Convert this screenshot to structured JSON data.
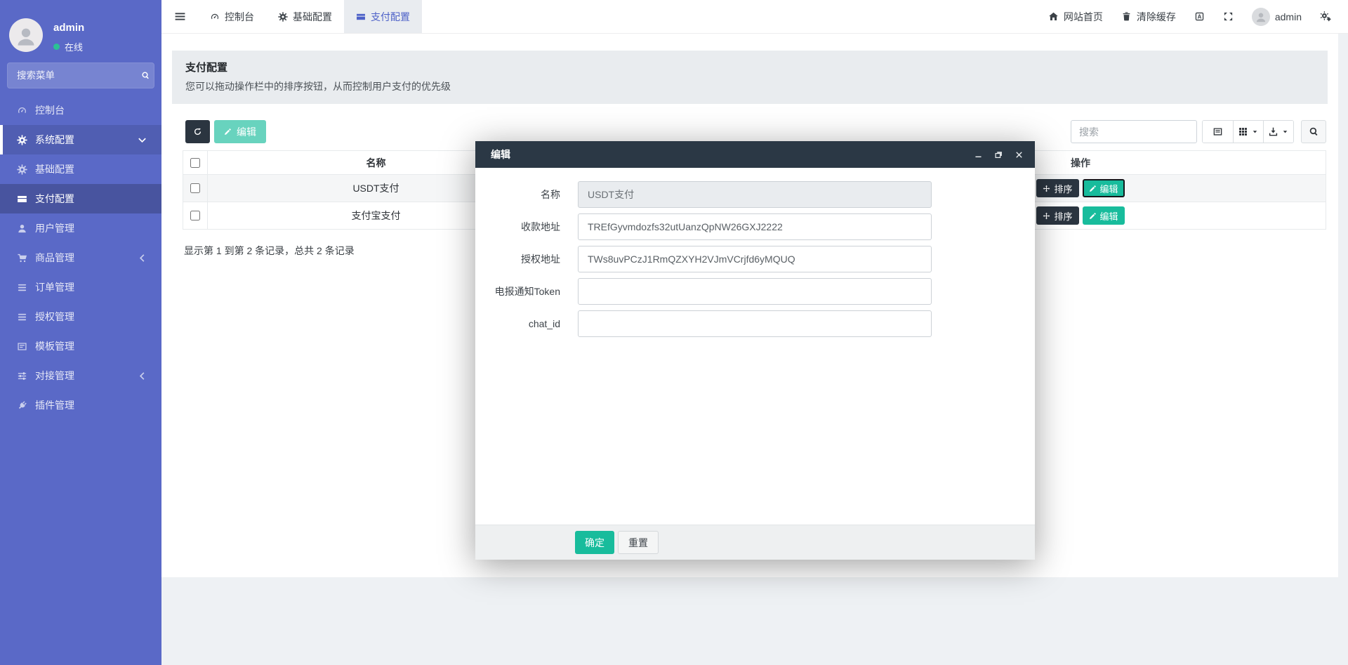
{
  "sidebar": {
    "user_name": "admin",
    "user_status": "在线",
    "search_placeholder": "搜索菜单",
    "items": [
      {
        "label": "控制台",
        "icon": "gauge-icon"
      },
      {
        "label": "系统配置",
        "icon": "gear-icon"
      },
      {
        "label": "基础配置",
        "icon": "gear-icon"
      },
      {
        "label": "支付配置",
        "icon": "payment-icon"
      },
      {
        "label": "用户管理",
        "icon": "user-icon"
      },
      {
        "label": "商品管理",
        "icon": "cart-icon"
      },
      {
        "label": "订单管理",
        "icon": "list-icon"
      },
      {
        "label": "授权管理",
        "icon": "list-icon"
      },
      {
        "label": "模板管理",
        "icon": "template-icon"
      },
      {
        "label": "对接管理",
        "icon": "sliders-icon"
      },
      {
        "label": "插件管理",
        "icon": "plug-icon"
      }
    ]
  },
  "navbar": {
    "tabs": [
      {
        "label": "控制台"
      },
      {
        "label": "基础配置"
      },
      {
        "label": "支付配置"
      }
    ],
    "home_label": "网站首页",
    "clear_cache_label": "清除缓存",
    "user_name": "admin"
  },
  "page": {
    "title": "支付配置",
    "subtitle": "您可以拖动操作栏中的排序按钮，从而控制用户支付的优先级"
  },
  "toolbar": {
    "edit_label": "编辑",
    "search_placeholder": "搜索"
  },
  "table": {
    "name_column": "名称",
    "action_column": "操作",
    "rows": [
      {
        "name": "USDT支付"
      },
      {
        "name": "支付宝支付"
      }
    ],
    "sort_label": "排序",
    "edit_label": "编辑",
    "summary": "显示第 1 到第 2 条记录，总共 2 条记录"
  },
  "modal": {
    "title": "编辑",
    "fields": [
      {
        "label": "名称",
        "value": "USDT支付"
      },
      {
        "label": "收款地址",
        "value": "TREfGyvmdozfs32utUanzQpNW26GXJ2222"
      },
      {
        "label": "授权地址",
        "value": "TWs8uvPCzJ1RmQZXYH2VJmVCrjfd6yMQUQ"
      },
      {
        "label": "电报通知Token",
        "value": ""
      },
      {
        "label": "chat_id",
        "value": ""
      }
    ],
    "ok_label": "确定",
    "reset_label": "重置"
  },
  "colors": {
    "accent_green": "#18bc9c",
    "sidebar_blue": "#5a69c7",
    "dark": "#2b3540",
    "modal_header": "#2b3845"
  }
}
